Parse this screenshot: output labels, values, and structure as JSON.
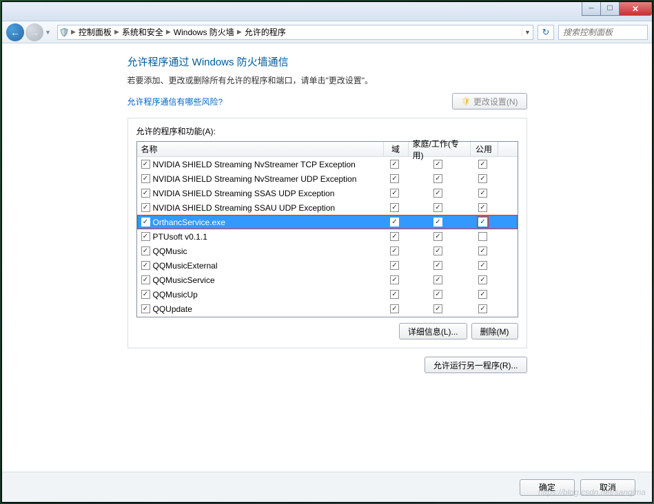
{
  "breadcrumb": {
    "items": [
      "控制面板",
      "系统和安全",
      "Windows 防火墙",
      "允许的程序"
    ]
  },
  "search": {
    "placeholder": "搜索控制面板"
  },
  "heading": "允许程序通过 Windows 防火墙通信",
  "subtext": "若要添加、更改或删除所有允许的程序和端口，请单击\"更改设置\"。",
  "risk_link": "允许程序通信有哪些风险?",
  "change_settings_btn": "更改设置(N)",
  "group_label": "允许的程序和功能(A):",
  "columns": {
    "name": "名称",
    "domain": "域",
    "home": "家庭/工作(专用)",
    "public": "公用"
  },
  "rows": [
    {
      "name": "NVIDIA SHIELD Streaming NvStreamer TCP Exception",
      "enabled": true,
      "domain": true,
      "home": true,
      "public": true,
      "selected": false
    },
    {
      "name": "NVIDIA SHIELD Streaming NvStreamer UDP Exception",
      "enabled": true,
      "domain": true,
      "home": true,
      "public": true,
      "selected": false
    },
    {
      "name": "NVIDIA SHIELD Streaming SSAS UDP Exception",
      "enabled": true,
      "domain": true,
      "home": true,
      "public": true,
      "selected": false
    },
    {
      "name": "NVIDIA SHIELD Streaming SSAU UDP Exception",
      "enabled": true,
      "domain": true,
      "home": true,
      "public": true,
      "selected": false
    },
    {
      "name": "OrthancService.exe",
      "enabled": true,
      "domain": true,
      "home": true,
      "public": true,
      "selected": true,
      "outlined": true
    },
    {
      "name": "PTUsoft v0.1.1",
      "enabled": true,
      "domain": true,
      "home": true,
      "public": false,
      "selected": false
    },
    {
      "name": "QQMusic",
      "enabled": true,
      "domain": true,
      "home": true,
      "public": true,
      "selected": false
    },
    {
      "name": "QQMusicExternal",
      "enabled": true,
      "domain": true,
      "home": true,
      "public": true,
      "selected": false
    },
    {
      "name": "QQMusicService",
      "enabled": true,
      "domain": true,
      "home": true,
      "public": true,
      "selected": false
    },
    {
      "name": "QQMusicUp",
      "enabled": true,
      "domain": true,
      "home": true,
      "public": true,
      "selected": false
    },
    {
      "name": "QQUpdate",
      "enabled": true,
      "domain": true,
      "home": true,
      "public": true,
      "selected": false
    }
  ],
  "details_btn": "详细信息(L)...",
  "remove_btn": "删除(M)",
  "allow_another_btn": "允许运行另一程序(R)...",
  "ok_btn": "确定",
  "cancel_btn": "取消",
  "watermark": "https://blog.csdn.net/sanqima"
}
